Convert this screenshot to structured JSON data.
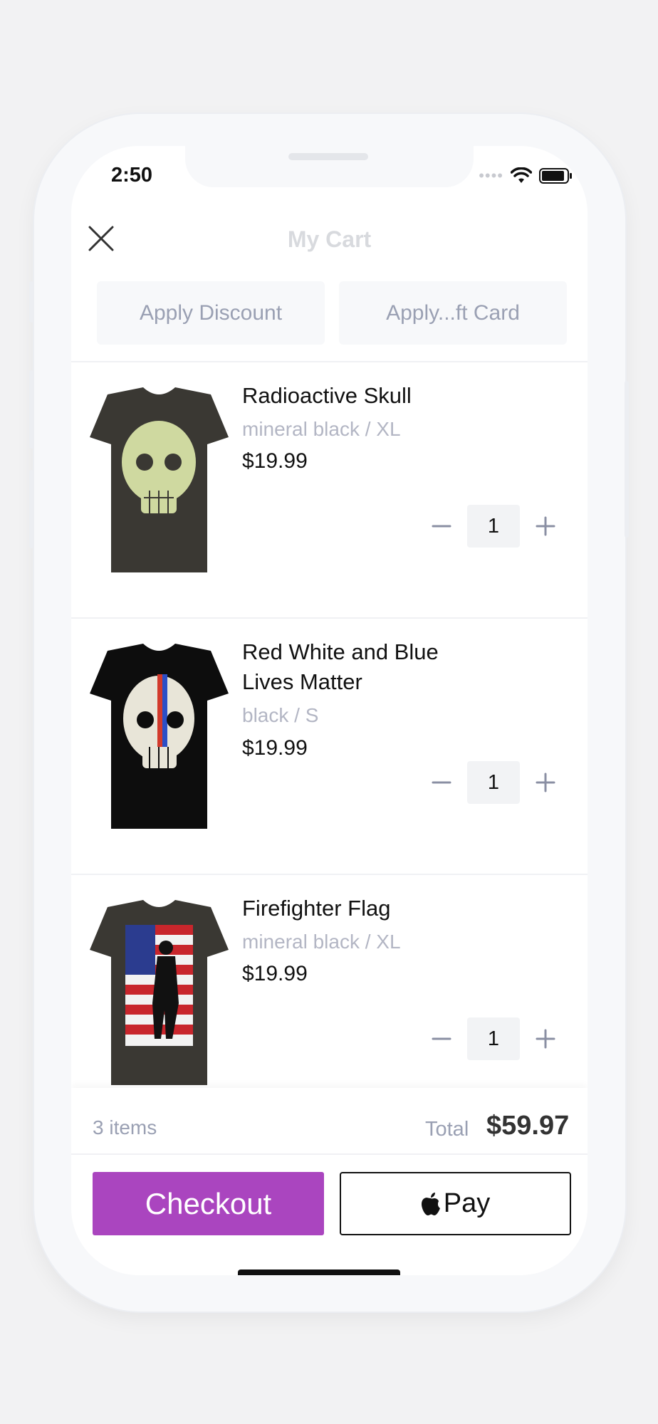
{
  "status_bar": {
    "time": "2:50",
    "signal_icon": "signal-dots-icon",
    "wifi_icon": "wifi-icon",
    "battery_icon": "battery-icon"
  },
  "header": {
    "title": "My Cart",
    "close_icon": "close-icon"
  },
  "actions": {
    "apply_discount": "Apply Discount",
    "apply_gift_card": "Apply...ft Card"
  },
  "cart": {
    "items": [
      {
        "name": "Radioactive Skull",
        "variant": "mineral black / XL",
        "price": "$19.99",
        "quantity": "1"
      },
      {
        "name": "Red White and Blue Lives Matter",
        "variant": "black / S",
        "price": "$19.99",
        "quantity": "1"
      },
      {
        "name": "Firefighter Flag",
        "variant": "mineral black / XL",
        "price": "$19.99",
        "quantity": "1"
      }
    ]
  },
  "summary": {
    "count": "3 items",
    "total_label": "Total",
    "total_value": "$59.97"
  },
  "buttons": {
    "checkout": "Checkout",
    "apple_pay": "Pay"
  },
  "colors": {
    "accent": "#aa45bf",
    "muted_text": "#9aa0b3"
  }
}
